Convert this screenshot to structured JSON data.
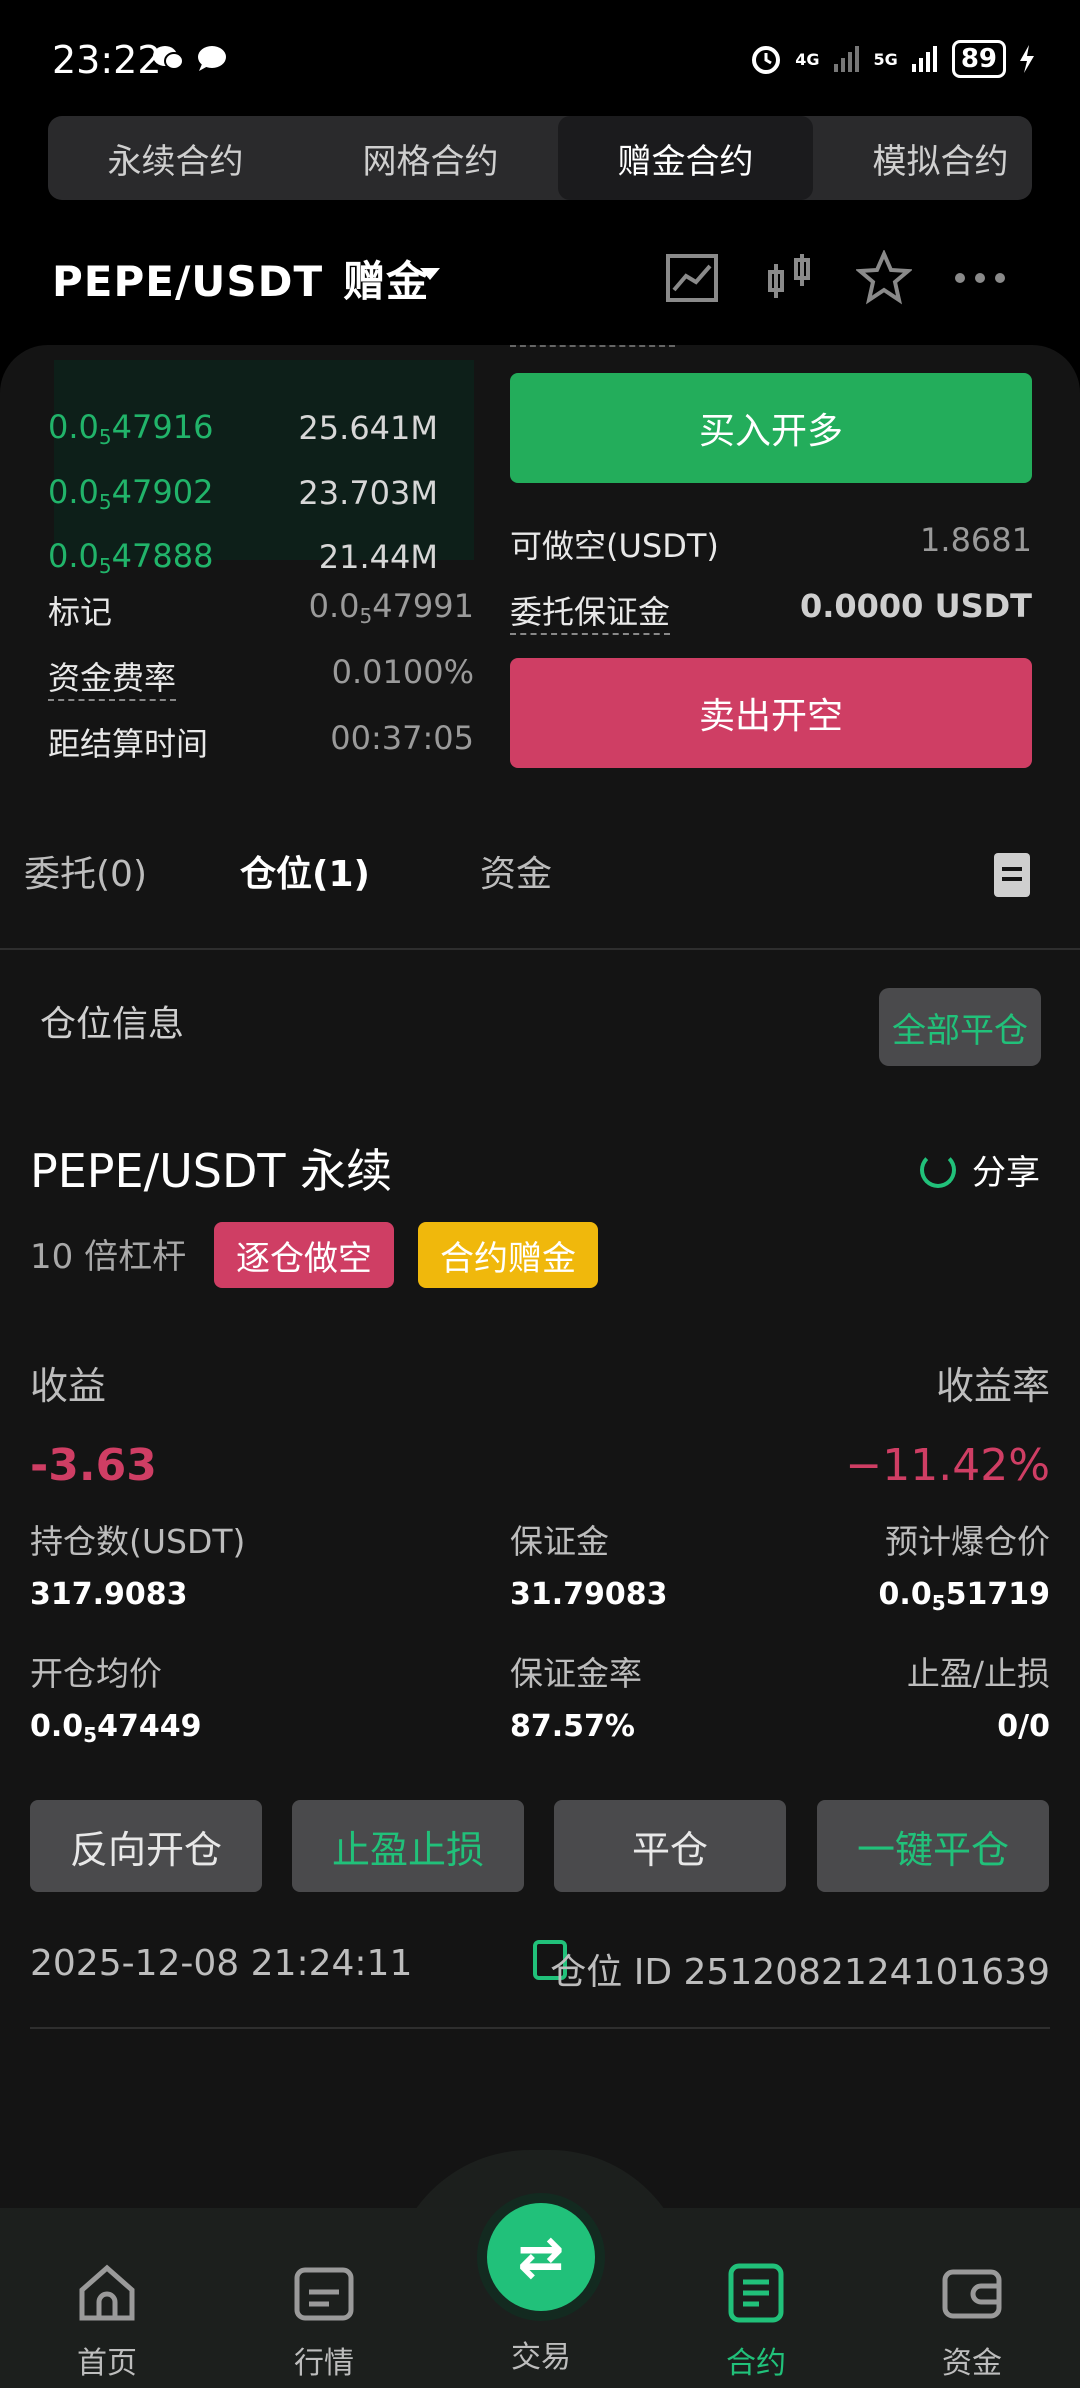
{
  "status_bar": {
    "time": "23:22",
    "network1": "4G",
    "network2": "5G",
    "battery": "89"
  },
  "top_tabs": [
    "永续合约",
    "网格合约",
    "赠金合约",
    "模拟合约"
  ],
  "header": {
    "pair": "PEPE/USDT",
    "tag": "赠金"
  },
  "order_book": [
    {
      "price_prefix": "0.0",
      "price_sub": "5",
      "price_rest": "47916",
      "size": "25.641M"
    },
    {
      "price_prefix": "0.0",
      "price_sub": "5",
      "price_rest": "47902",
      "size": "23.703M"
    },
    {
      "price_prefix": "0.0",
      "price_sub": "5",
      "price_rest": "47888",
      "size": "21.44M"
    }
  ],
  "market_info": {
    "mark_label": "标记",
    "mark_prefix": "0.0",
    "mark_sub": "5",
    "mark_rest": "47991",
    "funding_label": "资金费率",
    "funding_value": "0.0100%",
    "settle_label": "距结算时间",
    "settle_value": "00:37:05"
  },
  "trade": {
    "buy_label": "买入开多",
    "short_avail_label": "可做空(USDT)",
    "short_avail_value": "1.8681",
    "margin_label": "委托保证金",
    "margin_value": "0.0000 USDT",
    "sell_label": "卖出开空"
  },
  "sub_tabs": [
    "委托(0)",
    "仓位(1)",
    "资金"
  ],
  "position": {
    "section_title": "仓位信息",
    "close_all": "全部平仓",
    "contract": "PEPE/USDT 永续",
    "share": "分享",
    "leverage": "10 倍杠杆",
    "badge_short": "逐仓做空",
    "badge_bonus": "合约赠金",
    "pnl_label": "收益",
    "pnl_rate_label": "收益率",
    "pnl_value": "-3.63",
    "pnl_rate_value": "−11.42%",
    "size_label": "持仓数(USDT)",
    "size_value": "317.9083",
    "margin_label": "保证金",
    "margin_value": "31.79083",
    "liq_label": "预计爆仓价",
    "liq_prefix": "0.0",
    "liq_sub": "5",
    "liq_rest": "51719",
    "entry_label": "开仓均价",
    "entry_prefix": "0.0",
    "entry_sub": "5",
    "entry_rest": "47449",
    "margin_rate_label": "保证金率",
    "margin_rate_value": "87.57%",
    "tpsl_label": "止盈/止损",
    "tpsl_value": "0/0",
    "actions": [
      "反向开仓",
      "止盈止损",
      "平仓",
      "一键平仓"
    ],
    "timestamp": "2025-12-08 21:24:11",
    "position_id": "仓位 ID 2512082124101639"
  },
  "bottom_nav": [
    "首页",
    "行情",
    "交易",
    "合约",
    "资金"
  ],
  "colors": {
    "green": "#21c17a",
    "red": "#cf3e64",
    "yellow": "#f0b80c"
  }
}
